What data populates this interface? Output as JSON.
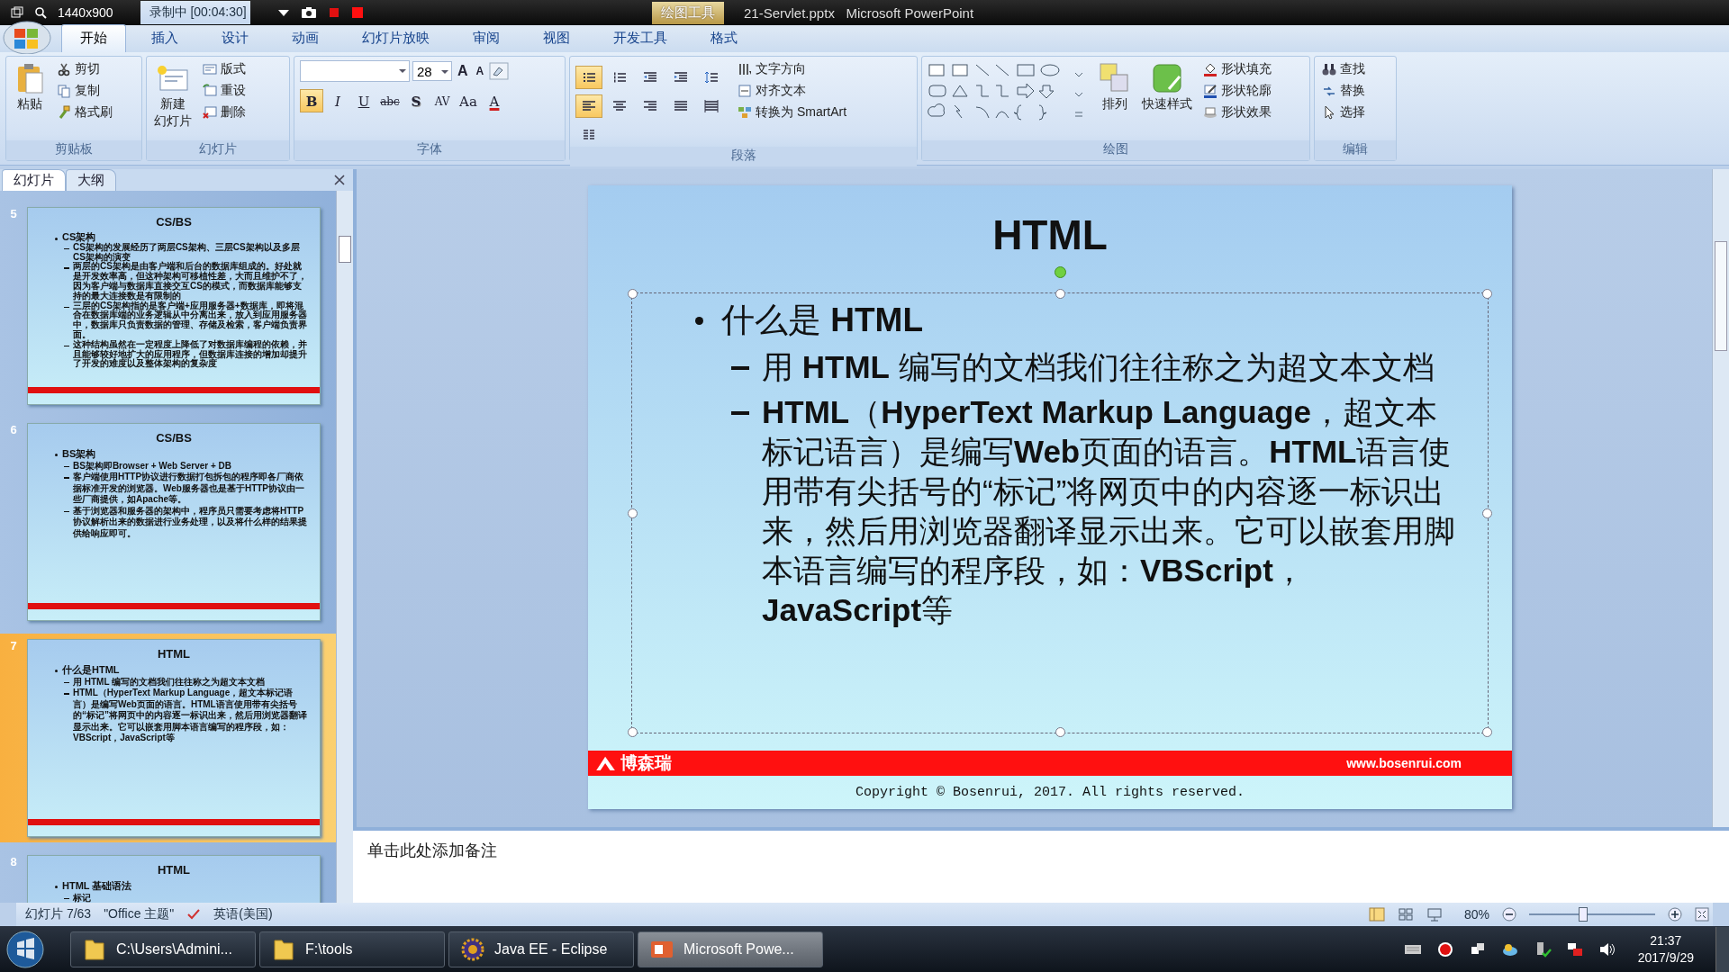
{
  "recorder": {
    "resolution": "1440x900",
    "status": "录制中 [00:04:30]"
  },
  "title_bar": {
    "context_tab": "绘图工具",
    "title": "21-Servlet.pptx   Microsoft PowerPoint"
  },
  "ribbon_tabs": [
    {
      "label": "开始",
      "selected": true
    },
    {
      "label": "插入",
      "selected": false
    },
    {
      "label": "设计",
      "selected": false
    },
    {
      "label": "动画",
      "selected": false
    },
    {
      "label": "幻灯片放映",
      "selected": false
    },
    {
      "label": "审阅",
      "selected": false
    },
    {
      "label": "视图",
      "selected": false
    },
    {
      "label": "开发工具",
      "selected": false
    },
    {
      "label": "格式",
      "selected": false
    }
  ],
  "ribbon": {
    "clipboard": {
      "title": "剪贴板",
      "paste": "粘贴",
      "items": [
        {
          "label": "剪切",
          "kind": "cut"
        },
        {
          "label": "复制",
          "kind": "copy"
        },
        {
          "label": "格式刷",
          "kind": "painter"
        }
      ]
    },
    "slides": {
      "title": "幻灯片",
      "new_slide": [
        "新建",
        "幻灯片"
      ],
      "items": [
        {
          "label": "版式",
          "kind": "layout"
        },
        {
          "label": "重设",
          "kind": "reset"
        },
        {
          "label": "删除",
          "kind": "delete"
        }
      ]
    },
    "font": {
      "title": "字体",
      "font_size": "28",
      "grow": "A",
      "shrink": "A",
      "format_buttons": [
        {
          "label": "B",
          "selected": true
        },
        {
          "label": "I",
          "selected": false
        },
        {
          "label": "U",
          "selected": false
        },
        {
          "label": "abc",
          "selected": false
        },
        {
          "label": "S",
          "selected": false
        },
        {
          "label": "AV",
          "selected": false
        },
        {
          "label": "Aa",
          "selected": false
        },
        {
          "label": "A",
          "selected": false
        }
      ]
    },
    "paragraph": {
      "title": "段落",
      "buttons": [
        {
          "kind": "bullets",
          "selected": true
        },
        {
          "kind": "numbering",
          "selected": false
        },
        {
          "kind": "outdent",
          "selected": false
        },
        {
          "kind": "indent",
          "selected": false
        },
        {
          "kind": "spacing",
          "selected": false
        },
        {
          "kind": "left",
          "selected": true
        },
        {
          "kind": "center",
          "selected": false
        },
        {
          "kind": "right",
          "selected": false
        },
        {
          "kind": "justify",
          "selected": false
        },
        {
          "kind": "distribute",
          "selected": false
        },
        {
          "kind": "columns",
          "selected": false
        }
      ],
      "items": [
        {
          "label": "文字方向",
          "kind": "text_direction"
        },
        {
          "label": "对齐文本",
          "kind": "align_text"
        },
        {
          "label": "转换为 SmartArt",
          "kind": "smartart"
        }
      ]
    },
    "drawing": {
      "title": "绘图",
      "arrange": "排列",
      "quick_styles": "快速样式",
      "items": [
        {
          "label": "形状填充",
          "kind": "fill"
        },
        {
          "label": "形状轮廓",
          "kind": "outline"
        },
        {
          "label": "形状效果",
          "kind": "effects"
        }
      ]
    },
    "editing": {
      "title": "编辑",
      "items": [
        {
          "label": "查找",
          "kind": "find"
        },
        {
          "label": "替换",
          "kind": "replace"
        },
        {
          "label": "选择",
          "kind": "select"
        }
      ]
    }
  },
  "panel_tabs": [
    {
      "label": "幻灯片",
      "selected": true
    },
    {
      "label": "大纲",
      "selected": false
    }
  ],
  "thumbnails": [
    {
      "number": "5",
      "title": "CS/BS",
      "selected": false,
      "bullets": [
        {
          "text": "CS架构",
          "children": [
            {
              "text": "CS架构的发展经历了两层CS架构、三层CS架构以及多层CS架构的演变"
            },
            {
              "text": "两层的CS架构是由客户端和后台的数据库组成的。好处就是开发效率高，但这种架构可移植性差，大而且维护不了，因为客户端与数据库直接交互CS的模式，而数据库能够支持的最大连接数是有限制的"
            },
            {
              "text": "三层的CS架构指的是客户端+应用服务器+数据库，即将混合在数据库端的业务逻辑从中分离出来，放入到应用服务器中，数据库只负责数据的管理、存储及检索，客户端负责界面。"
            },
            {
              "text": "这种结构虽然在一定程度上降低了对数据库编程的依赖，并且能够较好地扩大的应用程序，但数据库连接的增加却提升了开发的难度以及整体架构的复杂度"
            }
          ]
        }
      ]
    },
    {
      "number": "6",
      "title": "CS/BS",
      "selected": false,
      "bullets": [
        {
          "text": "BS架构",
          "children": [
            {
              "text": "BS架构即Browser + Web Server + DB"
            },
            {
              "text": "客户端使用HTTP协议进行数据打包拆包的程序即各厂商依据标准开发的浏览器。Web服务器也是基于HTTP协议由一些厂商提供，如Apache等。"
            },
            {
              "text": "基于浏览器和服务器的架构中，程序员只需要考虑将HTTP协议解析出来的数据进行业务处理，以及将什么样的结果提供给响应即可。"
            }
          ]
        }
      ]
    },
    {
      "number": "7",
      "title": "HTML",
      "selected": true,
      "bullets": [
        {
          "text": "什么是HTML",
          "children": [
            {
              "text": "用 HTML 编写的文档我们往往称之为超文本文档"
            },
            {
              "text": "HTML（HyperText Markup Language，超文本标记语言）是编写Web页面的语言。HTML语言使用带有尖括号的“标记”将网页中的内容逐一标识出来，然后用浏览器翻译显示出来。它可以嵌套用脚本语言编写的程序段，如：VBScript，JavaScript等"
            }
          ]
        }
      ]
    },
    {
      "number": "8",
      "title": "HTML",
      "selected": false,
      "bullets": [
        {
          "text": "HTML 基础语法",
          "children": [
            {
              "text": "标记"
            }
          ]
        }
      ]
    }
  ],
  "slide": {
    "title": "HTML",
    "bullets": [
      {
        "text": "什么是 **HTML**",
        "children": [
          {
            "text": "用 **HTML** 编写的文档我们往往称之为超文本文档"
          },
          {
            "text": "**HTML**（**HyperText Markup Language**，超文本标记语言）是编写**Web**页面的语言。**HTML**语言使用带有尖括号的“标记”将网页中的内容逐一标识出来，然后用浏览器翻译显示出来。它可以嵌套用脚本语言编写的程序段，如：**VBScript**，**JavaScript**等"
          }
        ]
      }
    ],
    "brand": "博森瑞",
    "url": "www.bosenrui.com",
    "copyright": "Copyright © Bosenrui, 2017. All rights reserved."
  },
  "notes": {
    "placeholder": "单击此处添加备注"
  },
  "status_bar": {
    "slide": "幻灯片 7/63",
    "theme": "\"Office 主题\"",
    "language": "英语(美国)",
    "zoom": "80%",
    "level": 0.42
  },
  "taskbar": {
    "items": [
      {
        "label": "C:\\Users\\Admini...",
        "kind": "folder",
        "selected": false
      },
      {
        "label": "F:\\tools",
        "kind": "folder",
        "selected": false
      },
      {
        "label": "Java EE - Eclipse",
        "kind": "eclipse",
        "selected": false
      },
      {
        "label": "Microsoft Powe...",
        "kind": "powerpoint",
        "selected": true
      }
    ],
    "time": "21:37",
    "date": "2017/9/29"
  }
}
